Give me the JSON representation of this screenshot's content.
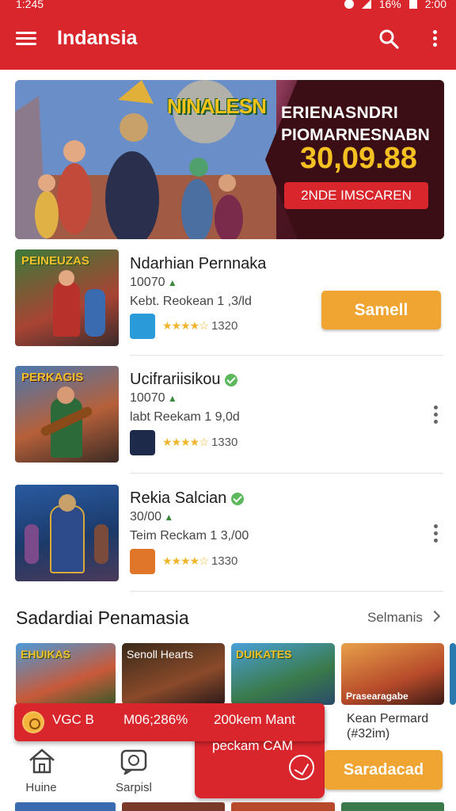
{
  "status_bar": {
    "time_left": "1:245",
    "battery": "16%",
    "time_right": "2:00"
  },
  "app_bar": {
    "title": "Indansia"
  },
  "hero": {
    "logo_text": "NINALESN",
    "line1": "ERIENASNDRI",
    "line2": "PIOMARNESNABN",
    "price": "30,09.88",
    "cta": "2NDE IMSCAREN"
  },
  "games": [
    {
      "thumb_label": "PEINEUZAS",
      "title": "Ndarhian Pernnaka",
      "verified": false,
      "count": "10070",
      "meta": "Kebt. Reokean 1 ,3/ld",
      "rating": "1320",
      "action": "Samell"
    },
    {
      "thumb_label": "PERKAGIS",
      "title": "Ucifrariisikou",
      "verified": true,
      "count": "10070",
      "meta": "labt Reekam 1 9,0d",
      "rating": "1330"
    },
    {
      "title": "Rekia Salcian",
      "verified": true,
      "count": "30/00",
      "meta": "Teim Reckam 1 3,/00",
      "rating": "1330"
    }
  ],
  "section": {
    "title": "Sadardiai Penamasia",
    "see_all": "Selmanis",
    "tiles": [
      {
        "label": "EHUIKAS"
      },
      {
        "label": "Senoll Hearts"
      },
      {
        "label": "DUIKATES"
      },
      {
        "label": "Prasearagabe"
      }
    ],
    "tile_caption_line1": "Kean Permard",
    "tile_caption_line2": "(#32im)"
  },
  "toast": {
    "label1": "VGC B",
    "label2": "M06;286%",
    "label3": "200kem Mant",
    "label4": "peckam CAM"
  },
  "cta_secondary": "Saradacad",
  "bottom_nav": [
    {
      "label": "Huine"
    },
    {
      "label": "Sarpisl"
    }
  ],
  "colors": {
    "primary": "#d9262c",
    "accent": "#f0a431",
    "star": "#f0b52a",
    "verified": "#5cb85c"
  }
}
